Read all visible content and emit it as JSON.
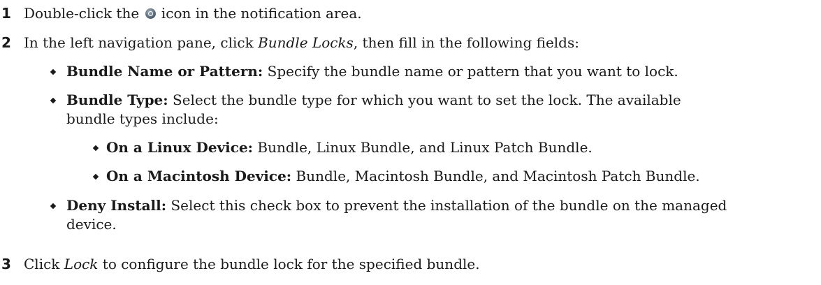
{
  "steps": [
    {
      "number": "1",
      "before": "Double-click the ",
      "icon": "zenworks-icon",
      "after": " icon in the notification area."
    },
    {
      "number": "2",
      "before": "In the left navigation pane, click ",
      "emph": "Bundle Locks",
      "after": ", then fill in the following fields:"
    },
    {
      "number": "3",
      "before": "Click ",
      "emph": "Lock",
      "after": " to configure the bundle lock for the specified bundle."
    }
  ],
  "fields": {
    "bundle_name": {
      "label": "Bundle Name or Pattern:",
      "text": " Specify the bundle name or pattern that you want to lock."
    },
    "bundle_type": {
      "label": "Bundle Type:",
      "line1": " Select the bundle type for which you want to set the lock. The available",
      "line2": "bundle types include:"
    },
    "linux": {
      "label": "On a Linux Device:",
      "text": " Bundle, Linux Bundle, and Linux Patch Bundle."
    },
    "mac": {
      "label": "On a Macintosh Device:",
      "text": " Bundle, Macintosh Bundle, and Macintosh Patch Bundle."
    },
    "deny_install": {
      "label": "Deny Install:",
      "line1": " Select this check box to prevent the installation of the bundle on the managed",
      "line2": "device."
    }
  }
}
